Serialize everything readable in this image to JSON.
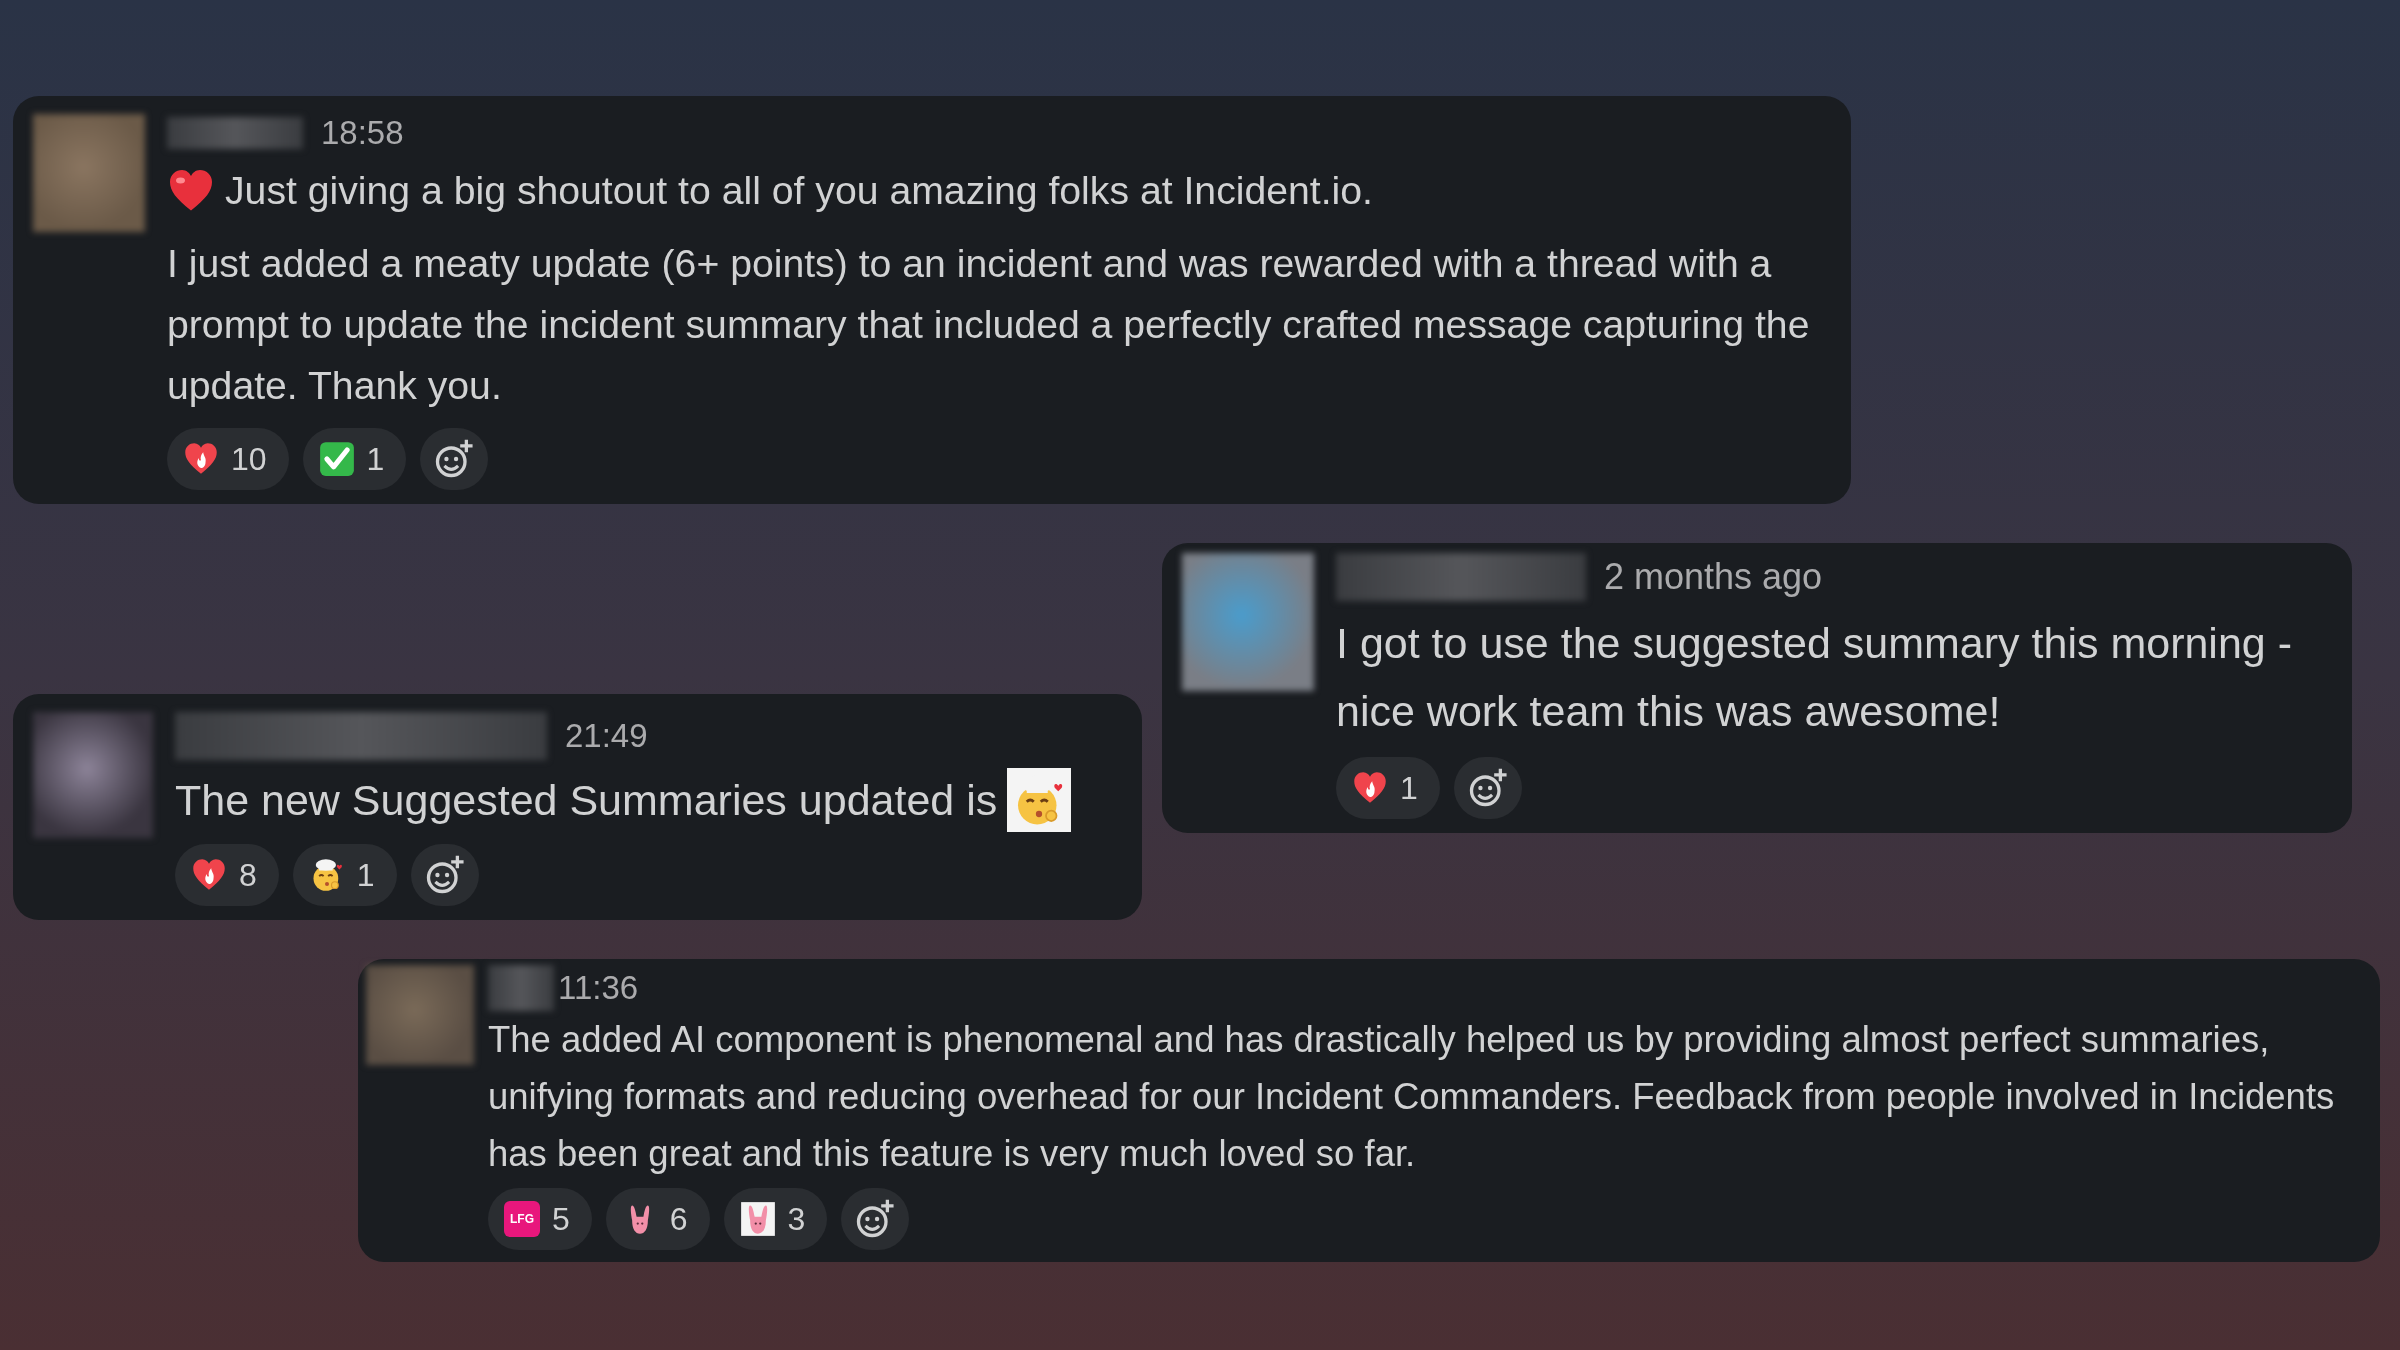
{
  "messages": [
    {
      "time": "18:58",
      "paragraphs": [
        {
          "text": "Just giving a big shoutout to all of you amazing folks at Incident.io.",
          "emoji": {
            "kind": "heart",
            "trailing": false
          }
        },
        {
          "text": "I just added a meaty update (6+ points) to an incident and was rewarded with a thread with a prompt to update the incident summary that included a perfectly crafted message capturing the update. Thank you."
        }
      ],
      "reactions": [
        {
          "kind": "heart-fire",
          "count": "10"
        },
        {
          "kind": "check",
          "count": "1"
        }
      ]
    },
    {
      "time": "2 months ago",
      "paragraphs": [
        {
          "text": "I got to use the suggested summary this morning - nice work team this was awesome!"
        }
      ],
      "reactions": [
        {
          "kind": "heart-fire",
          "count": "1"
        }
      ]
    },
    {
      "time": "21:49",
      "paragraphs": [
        {
          "text": "The new Suggested Summaries updated is",
          "emoji": {
            "kind": "chef-kiss",
            "trailing": true
          }
        }
      ],
      "reactions": [
        {
          "kind": "heart-fire",
          "count": "8"
        },
        {
          "kind": "chef-kiss",
          "count": "1"
        }
      ]
    },
    {
      "time": "11:36",
      "paragraphs": [
        {
          "text": "The added AI component is phenomenal and has drastically helped us by providing almost perfect summaries, unifying formats and reducing overhead for our Incident Commanders. Feedback from people involved in Incidents has been great and this feature is very much loved so far."
        }
      ],
      "reactions": [
        {
          "kind": "lfg",
          "badge": "LFG",
          "count": "5"
        },
        {
          "kind": "bunny-hand",
          "count": "6"
        },
        {
          "kind": "bunny-hand-framed",
          "count": "3"
        }
      ]
    }
  ]
}
